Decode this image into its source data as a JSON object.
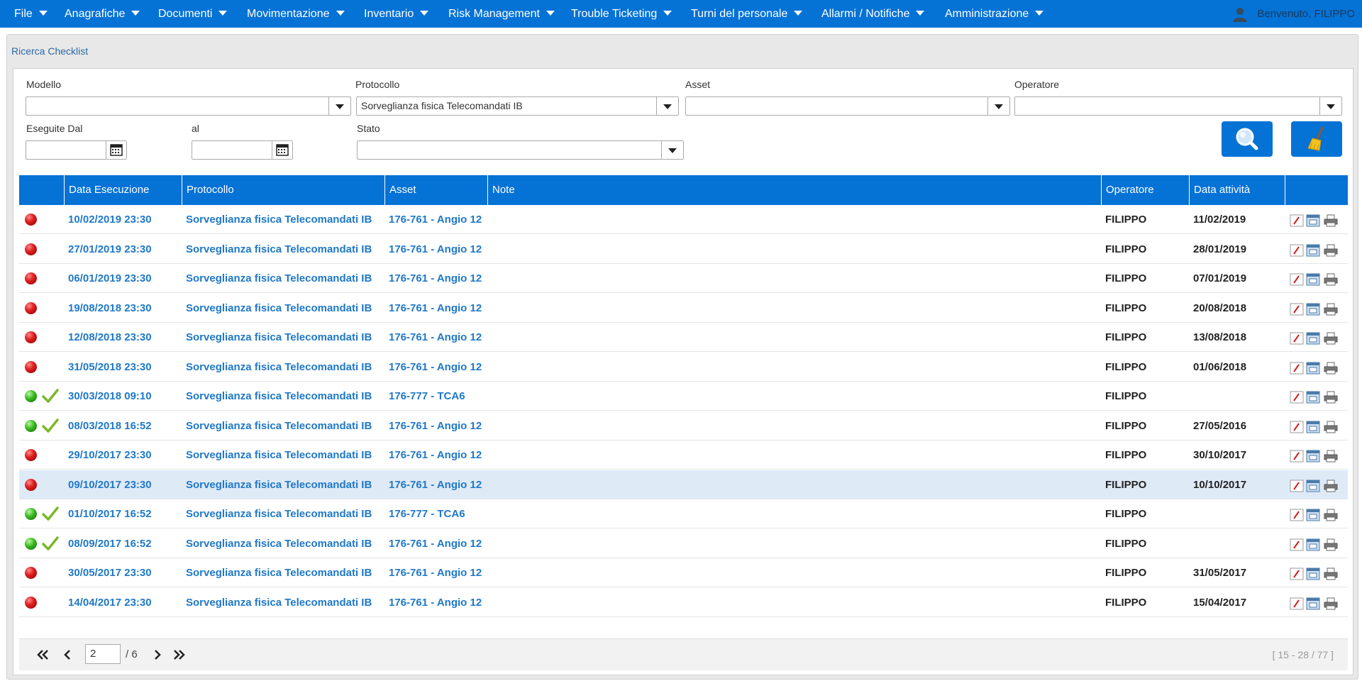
{
  "menu": {
    "items": [
      {
        "label": "File"
      },
      {
        "label": "Anagrafiche"
      },
      {
        "label": "Documenti"
      },
      {
        "label": "Movimentazione"
      },
      {
        "label": "Inventario"
      },
      {
        "label": "Risk Management"
      },
      {
        "label": "Trouble Ticketing"
      },
      {
        "label": "Turni del personale"
      },
      {
        "label": "Allarmi / Notifiche"
      },
      {
        "label": "Amministrazione"
      }
    ],
    "welcome": "Benvenuto, FILIPPO"
  },
  "panel": {
    "title": "Ricerca Checklist"
  },
  "filters": {
    "modello_label": "Modello",
    "modello_value": "",
    "protocollo_label": "Protocollo",
    "protocollo_value": "Sorveglianza fisica Telecomandati IB",
    "asset_label": "Asset",
    "asset_value": "",
    "operatore_label": "Operatore",
    "operatore_value": "",
    "eseguite_dal_label": "Eseguite Dal",
    "eseguite_dal_value": "",
    "al_label": "al",
    "al_value": "",
    "stato_label": "Stato",
    "stato_value": ""
  },
  "table": {
    "headers": {
      "data_esecuzione": "Data Esecuzione",
      "protocollo": "Protocollo",
      "asset": "Asset",
      "note": "Note",
      "operatore": "Operatore",
      "data_attivita": "Data attività"
    },
    "rows": [
      {
        "status": "red",
        "checked": false,
        "data": "10/02/2019 23:30",
        "protocollo": "Sorveglianza fisica Telecomandati IB",
        "asset": "176-761 - Angio 12",
        "note": "",
        "operatore": "FILIPPO",
        "data_attivita": "11/02/2019"
      },
      {
        "status": "red",
        "checked": false,
        "data": "27/01/2019 23:30",
        "protocollo": "Sorveglianza fisica Telecomandati IB",
        "asset": "176-761 - Angio 12",
        "note": "",
        "operatore": "FILIPPO",
        "data_attivita": "28/01/2019"
      },
      {
        "status": "red",
        "checked": false,
        "data": "06/01/2019 23:30",
        "protocollo": "Sorveglianza fisica Telecomandati IB",
        "asset": "176-761 - Angio 12",
        "note": "",
        "operatore": "FILIPPO",
        "data_attivita": "07/01/2019"
      },
      {
        "status": "red",
        "checked": false,
        "data": "19/08/2018 23:30",
        "protocollo": "Sorveglianza fisica Telecomandati IB",
        "asset": "176-761 - Angio 12",
        "note": "",
        "operatore": "FILIPPO",
        "data_attivita": "20/08/2018"
      },
      {
        "status": "red",
        "checked": false,
        "data": "12/08/2018 23:30",
        "protocollo": "Sorveglianza fisica Telecomandati IB",
        "asset": "176-761 - Angio 12",
        "note": "",
        "operatore": "FILIPPO",
        "data_attivita": "13/08/2018"
      },
      {
        "status": "red",
        "checked": false,
        "data": "31/05/2018 23:30",
        "protocollo": "Sorveglianza fisica Telecomandati IB",
        "asset": "176-761 - Angio 12",
        "note": "",
        "operatore": "FILIPPO",
        "data_attivita": "01/06/2018"
      },
      {
        "status": "green",
        "checked": true,
        "data": "30/03/2018 09:10",
        "protocollo": "Sorveglianza fisica Telecomandati IB",
        "asset": "176-777 - TCA6",
        "note": "",
        "operatore": "FILIPPO",
        "data_attivita": ""
      },
      {
        "status": "green",
        "checked": true,
        "data": "08/03/2018 16:52",
        "protocollo": "Sorveglianza fisica Telecomandati IB",
        "asset": "176-761 - Angio 12",
        "note": "",
        "operatore": "FILIPPO",
        "data_attivita": "27/05/2016"
      },
      {
        "status": "red",
        "checked": false,
        "data": "29/10/2017 23:30",
        "protocollo": "Sorveglianza fisica Telecomandati IB",
        "asset": "176-761 - Angio 12",
        "note": "",
        "operatore": "FILIPPO",
        "data_attivita": "30/10/2017"
      },
      {
        "status": "red",
        "checked": false,
        "data": "09/10/2017 23:30",
        "protocollo": "Sorveglianza fisica Telecomandati IB",
        "asset": "176-761 - Angio 12",
        "note": "",
        "operatore": "FILIPPO",
        "data_attivita": "10/10/2017",
        "selected": true
      },
      {
        "status": "green",
        "checked": true,
        "data": "01/10/2017 16:52",
        "protocollo": "Sorveglianza fisica Telecomandati IB",
        "asset": "176-777 - TCA6",
        "note": "",
        "operatore": "FILIPPO",
        "data_attivita": ""
      },
      {
        "status": "green",
        "checked": true,
        "data": "08/09/2017 16:52",
        "protocollo": "Sorveglianza fisica Telecomandati IB",
        "asset": "176-761 - Angio 12",
        "note": "",
        "operatore": "FILIPPO",
        "data_attivita": ""
      },
      {
        "status": "red",
        "checked": false,
        "data": "30/05/2017 23:30",
        "protocollo": "Sorveglianza fisica Telecomandati IB",
        "asset": "176-761 - Angio 12",
        "note": "",
        "operatore": "FILIPPO",
        "data_attivita": "31/05/2017"
      },
      {
        "status": "red",
        "checked": false,
        "data": "14/04/2017 23:30",
        "protocollo": "Sorveglianza fisica Telecomandati IB",
        "asset": "176-761 - Angio 12",
        "note": "",
        "operatore": "FILIPPO",
        "data_attivita": "15/04/2017"
      }
    ],
    "row_icons": [
      "status-dot-icon",
      "checkmark-icon",
      "edit-pencil-icon",
      "details-window-icon",
      "print-icon"
    ]
  },
  "pager": {
    "current_page": "2",
    "total": "/ 6",
    "range": "[ 15 - 28 / 77 ]",
    "icons": [
      "first-page-icon",
      "prev-page-icon",
      "next-page-icon",
      "last-page-icon"
    ]
  },
  "colors": {
    "primary": "#0572d6",
    "link": "#1f78c8",
    "selected_row": "#dfeaf7",
    "status_red": "#e02020",
    "status_green": "#38b820"
  }
}
